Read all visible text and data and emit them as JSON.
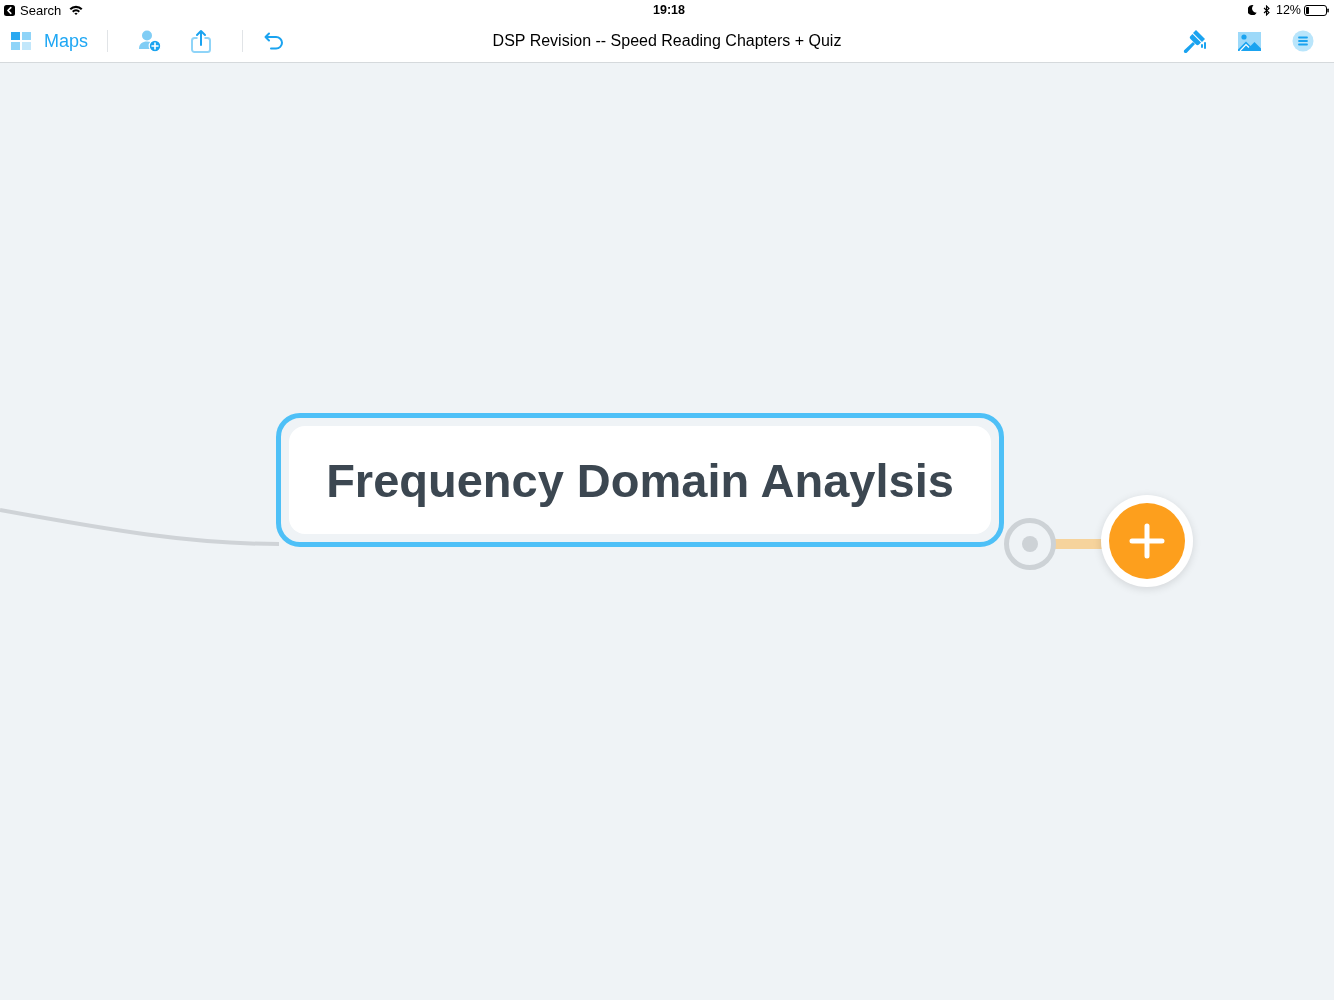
{
  "status_bar": {
    "back_label": "Search",
    "time": "19:18",
    "battery": "12%"
  },
  "toolbar": {
    "maps_label": "Maps",
    "title": "DSP Revision -- Speed Reading Chapters + Quiz"
  },
  "canvas": {
    "node": {
      "label": "Frequency Domain Anaylsis",
      "selected": true
    }
  }
}
